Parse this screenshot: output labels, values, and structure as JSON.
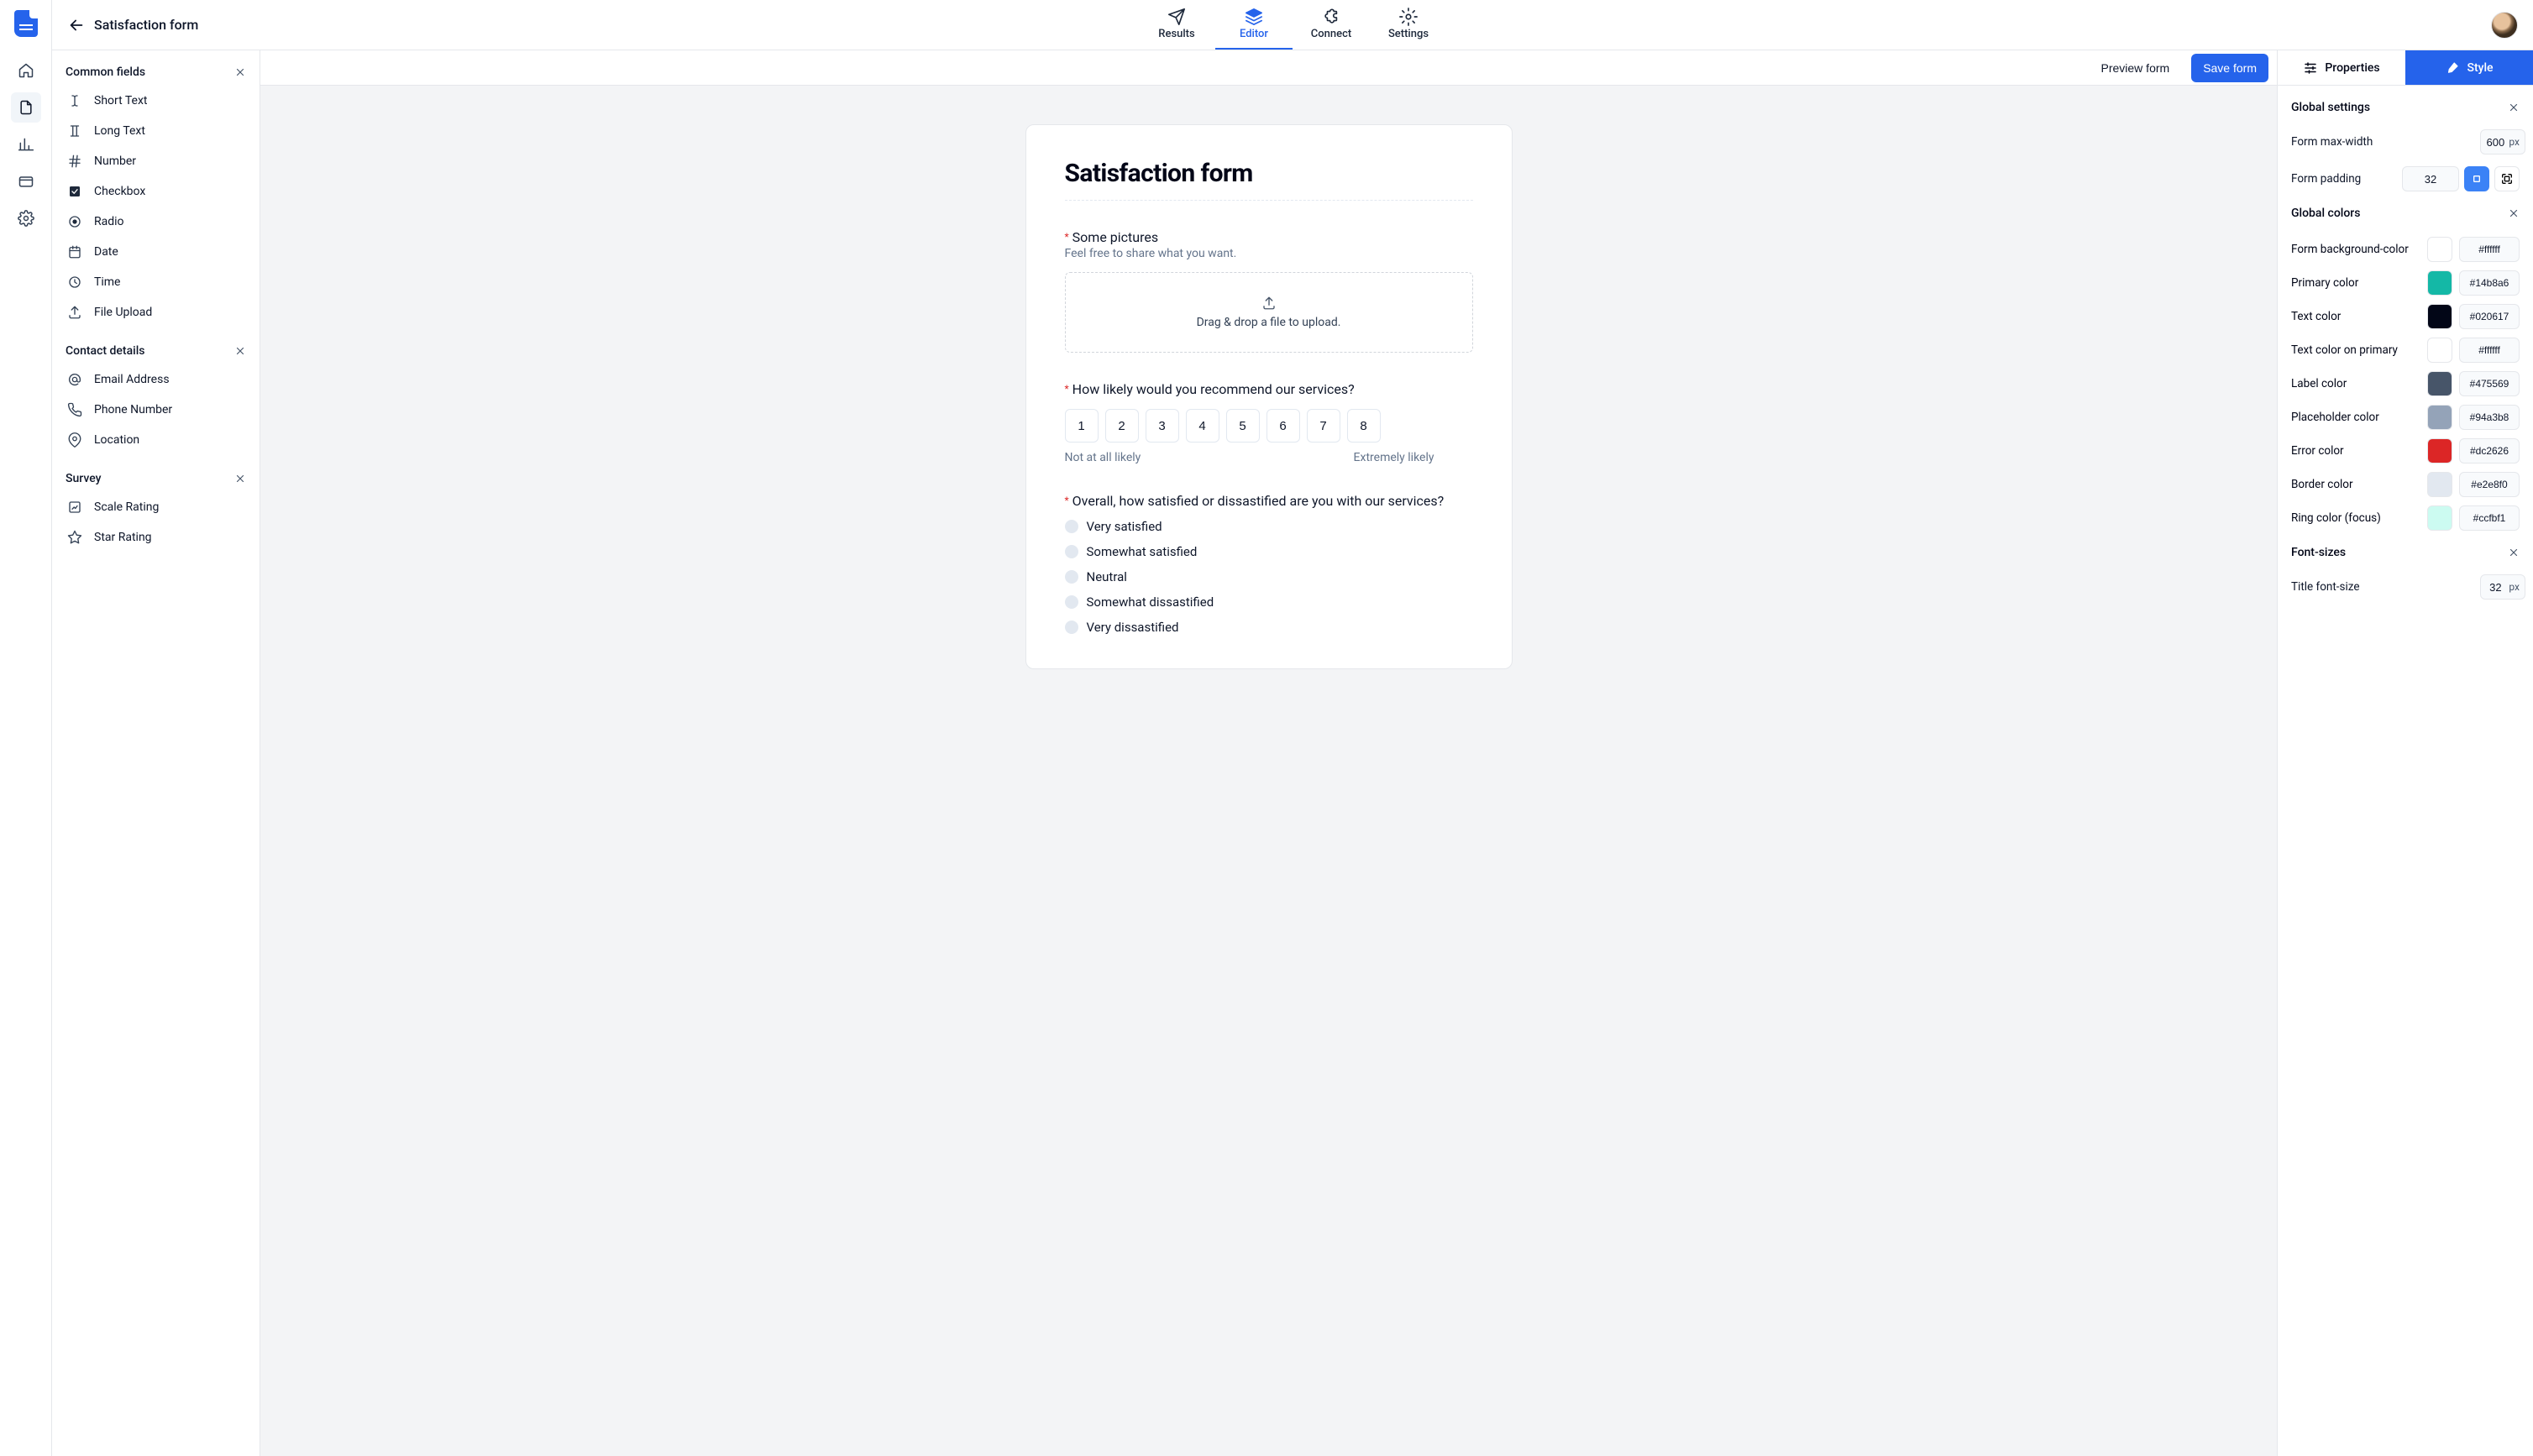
{
  "header": {
    "page_title": "Satisfaction form",
    "tabs": {
      "results": "Results",
      "editor": "Editor",
      "connect": "Connect",
      "settings": "Settings"
    }
  },
  "fields_sidebar": {
    "groups": [
      {
        "title": "Common fields",
        "items": [
          "Short Text",
          "Long Text",
          "Number",
          "Checkbox",
          "Radio",
          "Date",
          "Time",
          "File Upload"
        ]
      },
      {
        "title": "Contact details",
        "items": [
          "Email Address",
          "Phone Number",
          "Location"
        ]
      },
      {
        "title": "Survey",
        "items": [
          "Scale Rating",
          "Star Rating"
        ]
      }
    ]
  },
  "canvas_toolbar": {
    "preview": "Preview form",
    "save": "Save form"
  },
  "form": {
    "title": "Satisfaction form",
    "pictures": {
      "label": "Some pictures",
      "help": "Feel free to share what you want.",
      "upload_hint": "Drag & drop a file to upload."
    },
    "recommend": {
      "label": "How likely would you recommend our services?",
      "options": [
        "1",
        "2",
        "3",
        "4",
        "5",
        "6",
        "7",
        "8"
      ],
      "low": "Not at all likely",
      "high": "Extremely likely"
    },
    "satisfaction": {
      "label": "Overall, how satisfied or dissastified are you with our services?",
      "options": [
        "Very satisfied",
        "Somewhat satisfied",
        "Neutral",
        "Somewhat dissastified",
        "Very dissastified"
      ]
    }
  },
  "right_panel": {
    "tabs": {
      "properties": "Properties",
      "style": "Style"
    },
    "sections": {
      "global_settings": {
        "title": "Global settings",
        "max_width": {
          "label": "Form max-width",
          "value": "600",
          "unit": "px"
        },
        "padding": {
          "label": "Form padding",
          "value": "32"
        }
      },
      "global_colors": {
        "title": "Global colors",
        "rows": [
          {
            "label": "Form background-color",
            "hex": "#ffffff"
          },
          {
            "label": "Primary color",
            "hex": "#14b8a6"
          },
          {
            "label": "Text color",
            "hex": "#020617"
          },
          {
            "label": "Text color on primary",
            "hex": "#ffffff"
          },
          {
            "label": "Label color",
            "hex": "#475569"
          },
          {
            "label": "Placeholder color",
            "hex": "#94a3b8"
          },
          {
            "label": "Error color",
            "hex": "#dc2626"
          },
          {
            "label": "Border color",
            "hex": "#e2e8f0"
          },
          {
            "label": "Ring color (focus)",
            "hex": "#ccfbf1"
          }
        ]
      },
      "font_sizes": {
        "title": "Font-sizes",
        "title_size": {
          "label": "Title font-size",
          "value": "32",
          "unit": "px"
        }
      }
    }
  }
}
